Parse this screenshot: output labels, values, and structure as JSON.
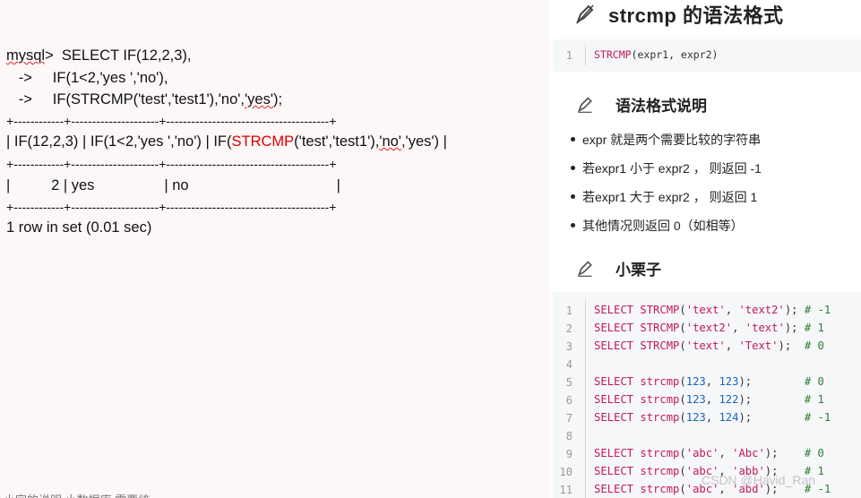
{
  "terminal": {
    "line1_prompt": "mysql",
    "line1_rest": ">  SELECT IF(12,2,3),",
    "line2": "   ->     IF(1<2,'yes ','no'),",
    "line3_a": "   ->     IF(STRCMP('test','test1'),'no',",
    "line3_b": "'yes'",
    "line3_c": ");",
    "border1": "+------------+---------------------+---------------------------------------+",
    "header_a": "| IF(12,2,3) | IF(1<2,'yes ','no') | IF(",
    "header_func": "STRCMP",
    "header_b": "('test','test1'),",
    "header_no": "'no'",
    "header_c": ",'yes') |",
    "border2": "+------------+---------------------+---------------------------------------+",
    "row": "|          2 | yes                 | no                                    |",
    "border3": "+------------+---------------------+---------------------------------------+",
    "summary": "1 row in set (0.01 sec)",
    "cutoff": "小字的说明 小数据库 需要统"
  },
  "doc": {
    "title": "strcmp 的语法格式",
    "syntax_line_no": "1",
    "syntax_func": "STRCMP",
    "syntax_args": "(expr1, expr2)",
    "section1": "语法格式说明",
    "bullets": [
      "expr 就是两个需要比较的字符串",
      "若expr1 小于 expr2 ， 则返回 -1",
      "若expr1 大于 expr2 ， 则返回 1",
      "其他情况则返回 0（如相等）"
    ],
    "section2": "小栗子",
    "examples": [
      {
        "no": "1",
        "kw": "SELECT STRCMP",
        "arg1": "'text'",
        "sep": ", ",
        "arg2": "'text2'",
        "end": ");",
        "pad": " ",
        "comment": "# -1"
      },
      {
        "no": "2",
        "kw": "SELECT STRCMP",
        "arg1": "'text2'",
        "sep": ", ",
        "arg2": "'text'",
        "end": ");",
        "pad": " ",
        "comment": "# 1"
      },
      {
        "no": "3",
        "kw": "SELECT STRCMP",
        "arg1": "'text'",
        "sep": ", ",
        "arg2": "'Text'",
        "end": ");",
        "pad": "  ",
        "comment": "# 0"
      },
      {
        "no": "4",
        "kw": "",
        "arg1": "",
        "sep": "",
        "arg2": "",
        "end": "",
        "pad": "",
        "comment": ""
      },
      {
        "no": "5",
        "kw": "SELECT strcmp",
        "arg1": "123",
        "sep": ", ",
        "arg2": "123",
        "end": ");",
        "pad": "        ",
        "comment": "# 0"
      },
      {
        "no": "6",
        "kw": "SELECT strcmp",
        "arg1": "123",
        "sep": ", ",
        "arg2": "122",
        "end": ");",
        "pad": "        ",
        "comment": "# 1"
      },
      {
        "no": "7",
        "kw": "SELECT strcmp",
        "arg1": "123",
        "sep": ", ",
        "arg2": "124",
        "end": ");",
        "pad": "        ",
        "comment": "# -1"
      },
      {
        "no": "8",
        "kw": "",
        "arg1": "",
        "sep": "",
        "arg2": "",
        "end": "",
        "pad": "",
        "comment": ""
      },
      {
        "no": "9",
        "kw": "SELECT strcmp",
        "arg1": "'abc'",
        "sep": ", ",
        "arg2": "'Abc'",
        "end": ");",
        "pad": "    ",
        "comment": "# 0"
      },
      {
        "no": "10",
        "kw": "SELECT strcmp",
        "arg1": "'abc'",
        "sep": ", ",
        "arg2": "'abb'",
        "end": ");",
        "pad": "    ",
        "comment": "# 1"
      },
      {
        "no": "11",
        "kw": "SELECT strcmp",
        "arg1": "'abc'",
        "sep": ", ",
        "arg2": "'abd'",
        "end": ");",
        "pad": "    ",
        "comment": "# -1"
      }
    ],
    "watermark": "CSDN @Havid_Ran"
  },
  "colors": {
    "accent_red": "#e00000",
    "code_pink": "#c2185b",
    "code_blue": "#1565c0",
    "code_green": "#2e7d32"
  }
}
